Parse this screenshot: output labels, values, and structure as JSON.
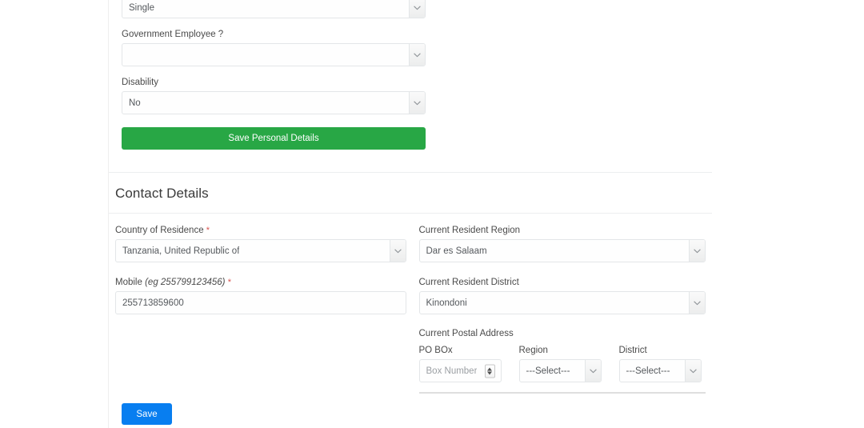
{
  "personal_details": {
    "marital_status": {
      "value": "Single",
      "control": "select"
    },
    "government_employee": {
      "label": "Government Employee ?",
      "value": "",
      "control": "select"
    },
    "disability": {
      "label": "Disability",
      "value": "No",
      "control": "select"
    },
    "save_button_label": "Save Personal Details"
  },
  "contact_details": {
    "title": "Contact Details",
    "country_of_residence": {
      "label": "Country of Residence",
      "required": "*",
      "value": "Tanzania, United Republic of",
      "control": "select"
    },
    "mobile": {
      "label": "Mobile",
      "hint": "(eg 255799123456)",
      "required": "*",
      "value": "255713859600",
      "control": "text"
    },
    "current_resident_region": {
      "label": "Current Resident Region",
      "value": "Dar es Salaam",
      "control": "select"
    },
    "current_resident_district": {
      "label": "Current Resident District",
      "value": "Kinondoni",
      "control": "select"
    },
    "current_postal_address": {
      "label": "Current Postal Address",
      "po_box": {
        "label": "PO BOx",
        "value": "",
        "placeholder": "Box Number",
        "control": "number"
      },
      "region": {
        "label": "Region",
        "value": "---Select---",
        "control": "select"
      },
      "district": {
        "label": "District",
        "value": "---Select---",
        "control": "select"
      }
    },
    "save_button_label": "Save"
  },
  "colors": {
    "success": "#28a745",
    "primary": "#087ef0",
    "required_asterisk": "#d9534f",
    "border": "#e3e6e8"
  }
}
